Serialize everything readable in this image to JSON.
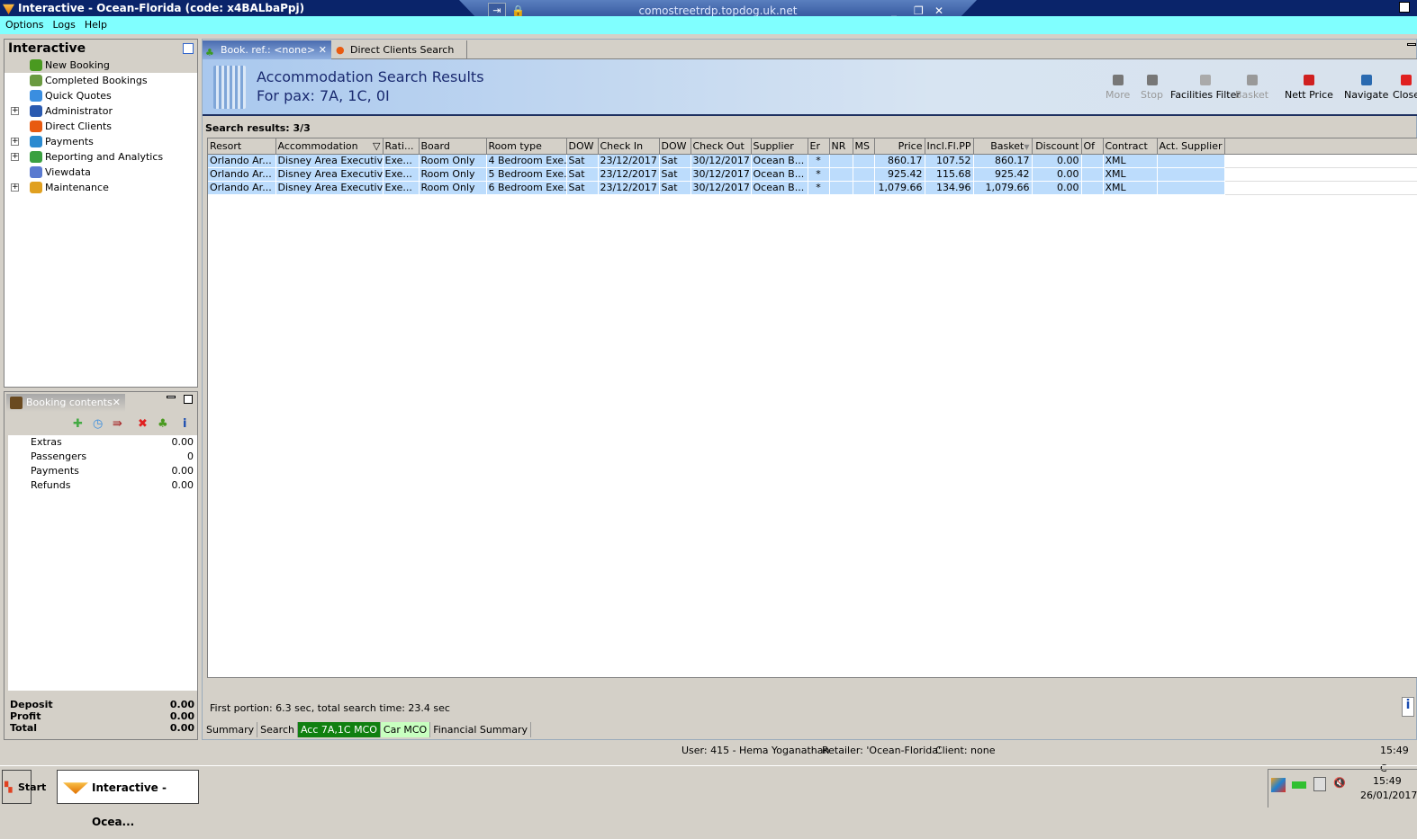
{
  "window": {
    "title": "Interactive - Ocean-Florida (code: x4BALbaPpj)",
    "rdp_host": "comostreetrdp.topdog.uk.net"
  },
  "menu": [
    "Options",
    "Logs",
    "Help"
  ],
  "nav": {
    "title": "Interactive",
    "items": [
      {
        "label": "New Booking",
        "expandable": false,
        "icon": "palm-tree-icon",
        "color": "#4a9a20"
      },
      {
        "label": "Completed Bookings",
        "expandable": false,
        "icon": "palm-money-icon",
        "color": "#6a9a40"
      },
      {
        "label": "Quick Quotes",
        "expandable": false,
        "icon": "clock-icon",
        "color": "#3a8ee0"
      },
      {
        "label": "Administrator",
        "expandable": true,
        "icon": "runner-icon",
        "color": "#2a5ab0"
      },
      {
        "label": "Direct Clients",
        "expandable": false,
        "icon": "person-icon",
        "color": "#e85a10"
      },
      {
        "label": "Payments",
        "expandable": true,
        "icon": "payment-card-icon",
        "color": "#2a8ad0"
      },
      {
        "label": "Reporting and Analytics",
        "expandable": true,
        "icon": "report-icon",
        "color": "#3aa040"
      },
      {
        "label": "Viewdata",
        "expandable": false,
        "icon": "globe-icon",
        "color": "#5a7ad0"
      },
      {
        "label": "Maintenance",
        "expandable": true,
        "icon": "toolbox-icon",
        "color": "#e0a020"
      }
    ]
  },
  "booking": {
    "tab": "Booking contents",
    "rows": [
      {
        "label": "Extras",
        "value": "0.00"
      },
      {
        "label": "Passengers",
        "value": "0"
      },
      {
        "label": "Payments",
        "value": "0.00"
      },
      {
        "label": "Refunds",
        "value": "0.00"
      }
    ],
    "totals": [
      {
        "label": "Deposit",
        "value": "0.00"
      },
      {
        "label": "Profit",
        "value": "0.00"
      },
      {
        "label": "Total",
        "value": "0.00"
      }
    ]
  },
  "tabs": [
    {
      "label": "Book. ref.: <none>",
      "active": true
    },
    {
      "label": "Direct Clients Search",
      "active": false
    }
  ],
  "header": {
    "title": "Accommodation Search Results",
    "subtitle": "For pax: 7A, 1C, 0I"
  },
  "toolbar": [
    {
      "label": "More",
      "enabled": false,
      "icon": "down-arrow-icon"
    },
    {
      "label": "Stop",
      "enabled": false,
      "icon": "stop-icon"
    },
    {
      "label": "Facilities Filter",
      "enabled": true,
      "icon": "filter-icon"
    },
    {
      "label": "Basket",
      "enabled": false,
      "icon": "basket-icon"
    },
    {
      "label": "Nett Price",
      "enabled": true,
      "icon": "nett-price-icon"
    },
    {
      "label": "Navigate",
      "enabled": true,
      "icon": "compass-icon"
    },
    {
      "label": "Close",
      "enabled": true,
      "icon": "close-icon"
    }
  ],
  "results": {
    "label": "Search results: 3/3",
    "columns": [
      "Resort",
      "Accommodation",
      "Rati...",
      "Board",
      "Room type",
      "DOW",
      "Check In",
      "DOW",
      "Check Out",
      "Supplier",
      "Er",
      "NR",
      "MS",
      "Price",
      "Incl.Fl.PP",
      "Basket",
      "Discount",
      "Of",
      "Contract",
      "Act. Supplier"
    ],
    "rows": [
      [
        "Orlando Ar...",
        "Disney Area Executiv...",
        "Exe...",
        "Room Only",
        "4 Bedroom Exe...",
        "Sat",
        "23/12/2017",
        "Sat",
        "30/12/2017",
        "Ocean B...",
        "*",
        "",
        "",
        "860.17",
        "107.52",
        "860.17",
        "0.00",
        "",
        "XML",
        ""
      ],
      [
        "Orlando Ar...",
        "Disney Area Executiv...",
        "Exe...",
        "Room Only",
        "5 Bedroom Exe...",
        "Sat",
        "23/12/2017",
        "Sat",
        "30/12/2017",
        "Ocean B...",
        "*",
        "",
        "",
        "925.42",
        "115.68",
        "925.42",
        "0.00",
        "",
        "XML",
        ""
      ],
      [
        "Orlando Ar...",
        "Disney Area Executiv...",
        "Exe...",
        "Room Only",
        "6 Bedroom Exe...",
        "Sat",
        "23/12/2017",
        "Sat",
        "30/12/2017",
        "Ocean B...",
        "*",
        "",
        "",
        "1,079.66",
        "134.96",
        "1,079.66",
        "0.00",
        "",
        "XML",
        ""
      ]
    ]
  },
  "timing": "First portion: 6.3 sec, total search time: 23.4 sec",
  "bottom_tabs": [
    {
      "label": "Summary",
      "bg": "#d4d0c8",
      "fg": "#000"
    },
    {
      "label": "Search",
      "bg": "#d4d0c8",
      "fg": "#000"
    },
    {
      "label": "Acc 7A,1C MCO",
      "bg": "#108010",
      "fg": "#fff"
    },
    {
      "label": "Car MCO",
      "bg": "#c8ffc0",
      "fg": "#000"
    },
    {
      "label": "Financial Summary",
      "bg": "#d4d0c8",
      "fg": "#000"
    }
  ],
  "status": {
    "user": "User: 415 - Hema Yoganathan",
    "retailer": "Retailer: 'Ocean-Florida'",
    "client": "Client: none",
    "time": "15:49 C"
  },
  "taskbar": {
    "start": "Start",
    "task": "Interactive - Ocea...",
    "time": "15:49",
    "date": "26/01/2017"
  }
}
